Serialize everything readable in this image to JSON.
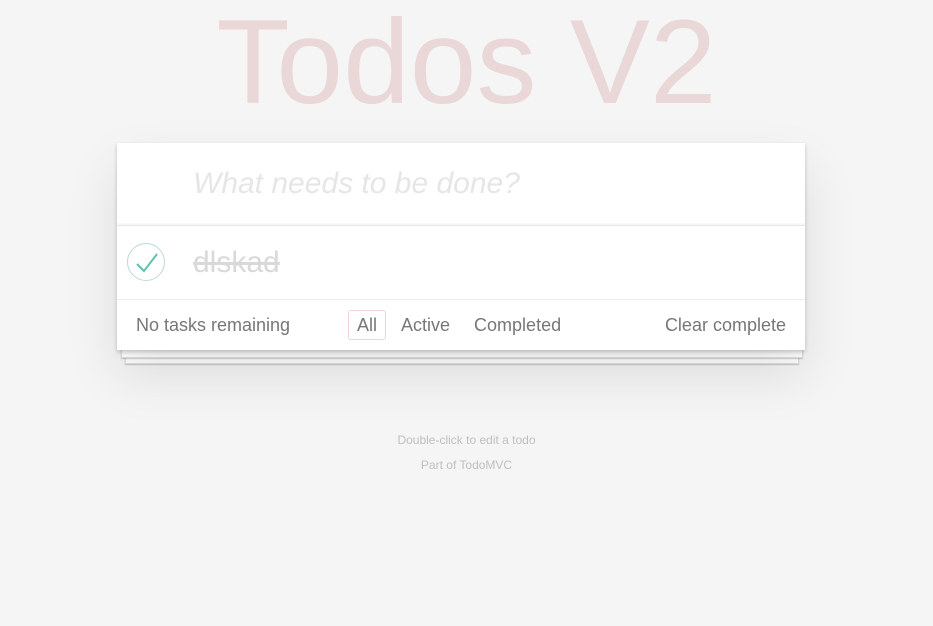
{
  "header": {
    "title": "Todos V2"
  },
  "new_todo": {
    "placeholder": "What needs to be done?",
    "value": ""
  },
  "todos": [
    {
      "label": "dlskad",
      "completed": true
    }
  ],
  "footer": {
    "count_text": "No tasks remaining",
    "filters": [
      {
        "label": "All",
        "selected": true
      },
      {
        "label": "Active",
        "selected": false
      },
      {
        "label": "Completed",
        "selected": false
      }
    ],
    "clear_label": "Clear complete"
  },
  "info": {
    "hint": "Double-click to edit a todo",
    "credit": "Part of TodoMVC"
  },
  "colors": {
    "title": "#efd9d9",
    "check": "#5dc2af",
    "toggle_border": "#bddad5",
    "completed_text": "#d9d9d9",
    "selected_filter_border": "#efd5d5"
  },
  "icons": {
    "toggle": "check-icon"
  }
}
